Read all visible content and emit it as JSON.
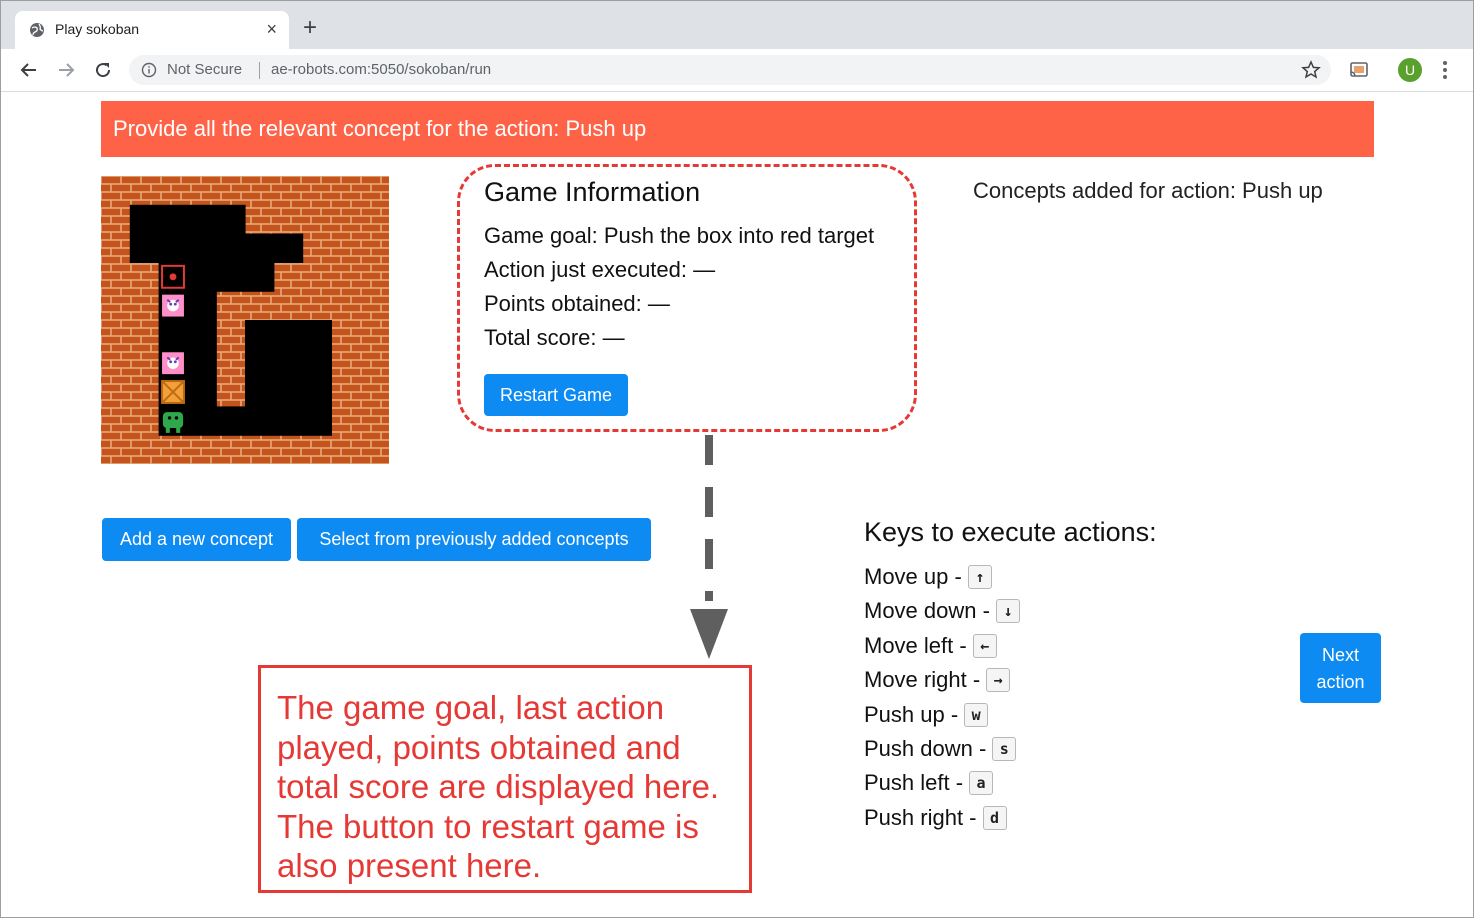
{
  "browser": {
    "tab_title": "Play sokoban",
    "tab_close": "×",
    "new_tab": "+",
    "security_label": "Not Secure",
    "url": "ae-robots.com:5050/sokoban/run",
    "profile_initial": "U"
  },
  "banner": {
    "text": "Provide all the relevant concept for the action: Push up"
  },
  "game_board": {
    "cells": [
      "WWWWWWWWWW",
      "WFFFFWWWWW",
      "WFFFFFFWWW",
      "WWTFFFWWWW",
      "WWEFWWWWWW",
      "WWFFWFFFWW",
      "WWEFWFFFWW",
      "WWBFWFFFWW",
      "WWPFFFFFWW",
      "WWWWWWWWWW"
    ],
    "legend": {
      "W": "brick-wall",
      "F": "floor",
      "T": "red-target",
      "E": "pink-creature",
      "B": "crate",
      "P": "green-robot"
    },
    "colors": {
      "wall": "#c4541b",
      "mortar": "#e8a97a",
      "floor": "#000000",
      "target": "#e53935",
      "creature": "#ff8fc8",
      "crate": "#f2a13a",
      "robot": "#2ea84a"
    }
  },
  "game_info": {
    "title": "Game Information",
    "goal": "Game goal: Push the box into red target",
    "last_action": "Action just executed: —",
    "points": "Points obtained: —",
    "total_score": "Total score: —",
    "restart_label": "Restart Game"
  },
  "concepts": {
    "title": "Concepts added for action: Push up"
  },
  "buttons": {
    "add_concept": "Add a new concept",
    "select_previous": "Select from previously added concepts",
    "next_action_line1": "Next",
    "next_action_line2": "action"
  },
  "keys": {
    "title": "Keys to execute actions:",
    "items": [
      {
        "label": "Move up -",
        "key": "↑"
      },
      {
        "label": "Move down -",
        "key": "↓"
      },
      {
        "label": "Move left -",
        "key": "←"
      },
      {
        "label": "Move right -",
        "key": "→"
      },
      {
        "label": "Push up -",
        "key": "w"
      },
      {
        "label": "Push down -",
        "key": "s"
      },
      {
        "label": "Push left -",
        "key": "a"
      },
      {
        "label": "Push right -",
        "key": "d"
      }
    ]
  },
  "annotation": {
    "text": "The game goal, last action played, points obtained and total score are displayed here. The button to restart game is also present here."
  },
  "colors": {
    "banner": "#ff6347",
    "primary_button": "#0d8bf2",
    "annotation_red": "#e53935"
  }
}
